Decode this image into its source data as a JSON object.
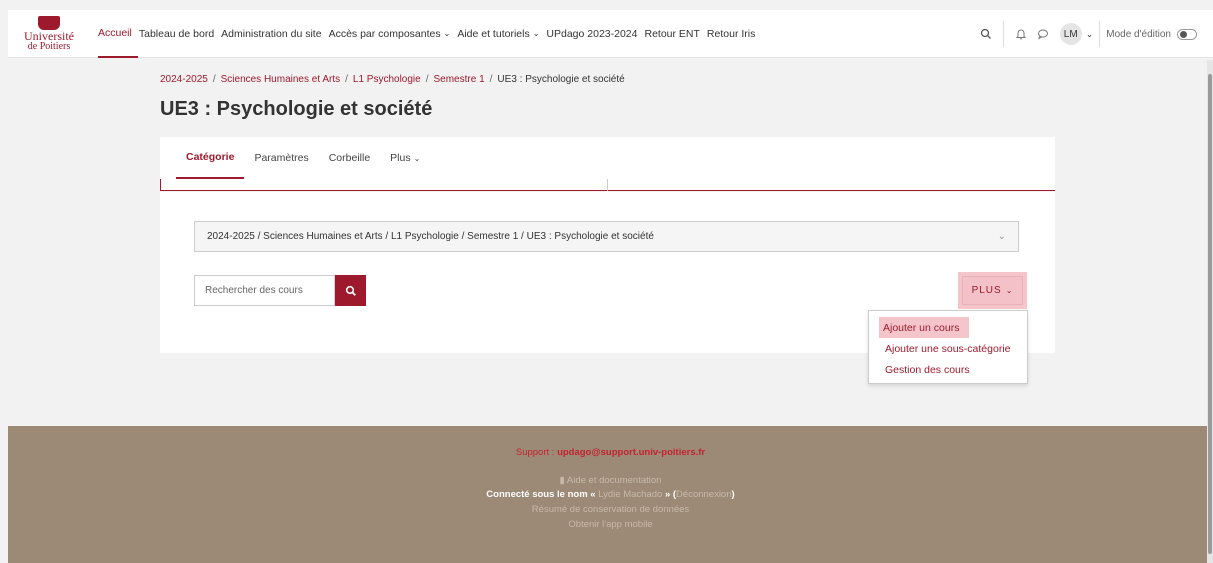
{
  "logo": {
    "line1": "Université",
    "line2": "de Poitiers"
  },
  "nav": {
    "items": [
      {
        "label": "Accueil",
        "active": true,
        "dropdown": false
      },
      {
        "label": "Tableau de bord",
        "active": false,
        "dropdown": false
      },
      {
        "label": "Administration du site",
        "active": false,
        "dropdown": false
      },
      {
        "label": "Accès par composantes",
        "active": false,
        "dropdown": true
      },
      {
        "label": "Aide et tutoriels",
        "active": false,
        "dropdown": true
      },
      {
        "label": "UPdago 2023-2024",
        "active": false,
        "dropdown": false
      },
      {
        "label": "Retour ENT",
        "active": false,
        "dropdown": false
      },
      {
        "label": "Retour Iris",
        "active": false,
        "dropdown": false
      }
    ],
    "user_initials": "LM",
    "edit_mode_label": "Mode d'édition"
  },
  "breadcrumb": {
    "items": [
      "2024-2025",
      "Sciences Humaines et Arts",
      "L1 Psychologie",
      "Semestre 1"
    ],
    "current": "UE3 : Psychologie et société"
  },
  "page_title": "UE3 : Psychologie et société",
  "tabs": [
    {
      "label": "Catégorie",
      "active": true
    },
    {
      "label": "Paramètres",
      "active": false
    },
    {
      "label": "Corbeille",
      "active": false
    },
    {
      "label": "Plus",
      "active": false
    }
  ],
  "category_select": {
    "value": "2024-2025 / Sciences Humaines et Arts / L1 Psychologie / Semestre 1 / UE3 : Psychologie et société"
  },
  "search": {
    "placeholder": "Rechercher des cours"
  },
  "plus_button": {
    "label": "PLUS"
  },
  "dropdown": {
    "items": [
      {
        "label": "Ajouter un cours",
        "highlighted": true
      },
      {
        "label": "Ajouter une sous-catégorie",
        "highlighted": false
      },
      {
        "label": "Gestion des cours",
        "highlighted": false
      }
    ]
  },
  "footer": {
    "support_prefix": "Support : ",
    "support_email": "updago@support.univ-poitiers.fr",
    "help_label": "Aide et documentation",
    "connected_prefix": "Connecté sous le nom « ",
    "user_name": "Lydie Machado",
    "connected_mid": " » (",
    "logout_label": "Déconnexion",
    "connected_suffix": ")",
    "privacy_label": "Résumé de conservation de données",
    "app_label": "Obtenir l'app mobile"
  },
  "colors": {
    "accent": "#9c1a2c",
    "footer_bg": "#9c8a77",
    "highlight": "#f4c6cb"
  }
}
